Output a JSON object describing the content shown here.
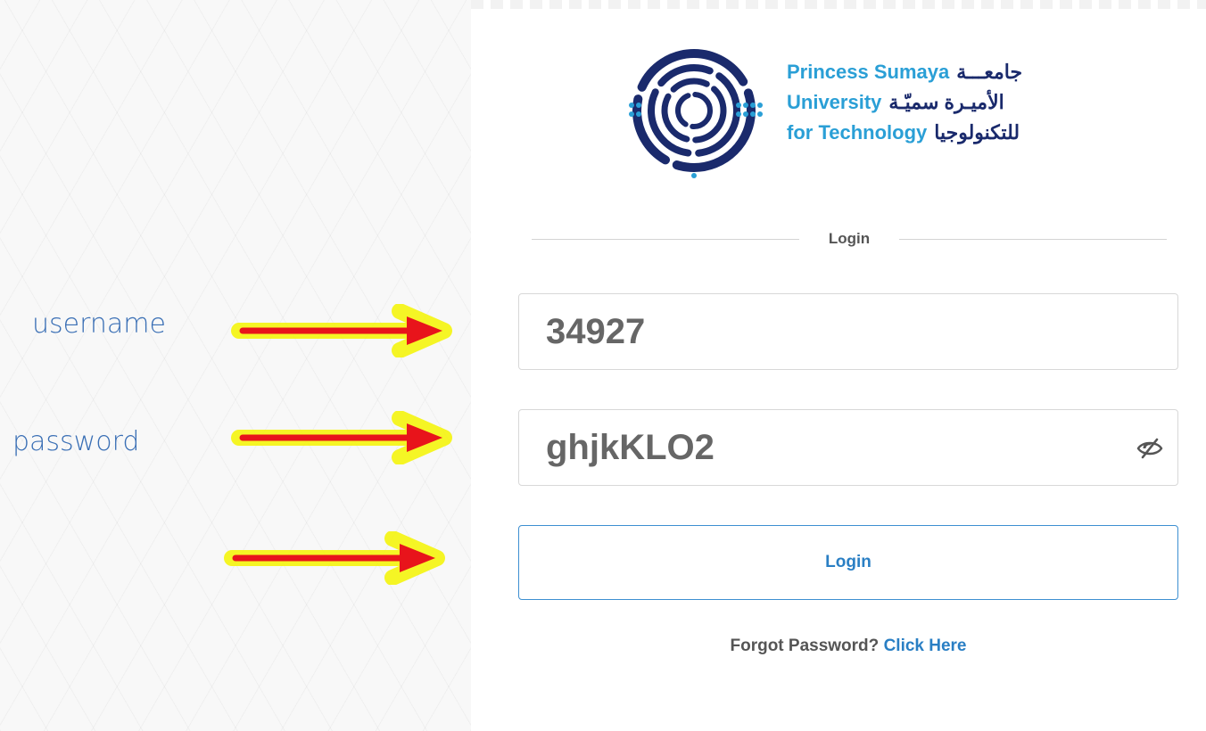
{
  "logo": {
    "lines": [
      {
        "en": "Princess Sumaya",
        "ar": "جامعـــة"
      },
      {
        "en": "University",
        "ar": "الأميـرة سميّـة"
      },
      {
        "en": "for Technology",
        "ar": "للتكنولوجيا"
      }
    ]
  },
  "form": {
    "section_title": "Login",
    "username_value": "34927",
    "password_value": "ghjkKLO2",
    "login_label": "Login",
    "forgot_text": "Forgot Password?",
    "forgot_link": "Click Here"
  },
  "annotations": {
    "username_label": "username",
    "password_label": "password",
    "arrow_color": "#e8141b",
    "arrow_glow": "#f4f400"
  },
  "colors": {
    "accent_blue": "#2a7fc4",
    "logo_light_blue": "#2a9fd6",
    "logo_navy": "#1a2a6c"
  },
  "icons": {
    "password_toggle": "eye-slash-icon",
    "logo": "psut-maze-logo"
  }
}
